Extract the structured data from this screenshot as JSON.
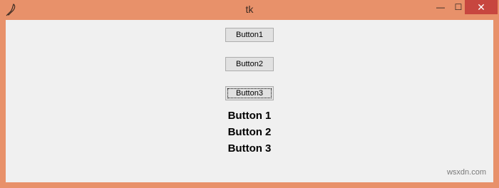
{
  "window": {
    "title": "tk",
    "minimize_glyph": "—",
    "maximize_glyph": "☐",
    "close_glyph": "✕",
    "icon": "feather-icon"
  },
  "buttons": [
    {
      "label": "Button1",
      "focused": false
    },
    {
      "label": "Button2",
      "focused": false
    },
    {
      "label": "Button3",
      "focused": true
    }
  ],
  "labels": [
    "Button 1",
    "Button 2",
    "Button 3"
  ],
  "watermark": "wsxdn.com",
  "colors": {
    "titlebar": "#e8916a",
    "client": "#f0f0f0",
    "close_button": "#c7463f"
  }
}
